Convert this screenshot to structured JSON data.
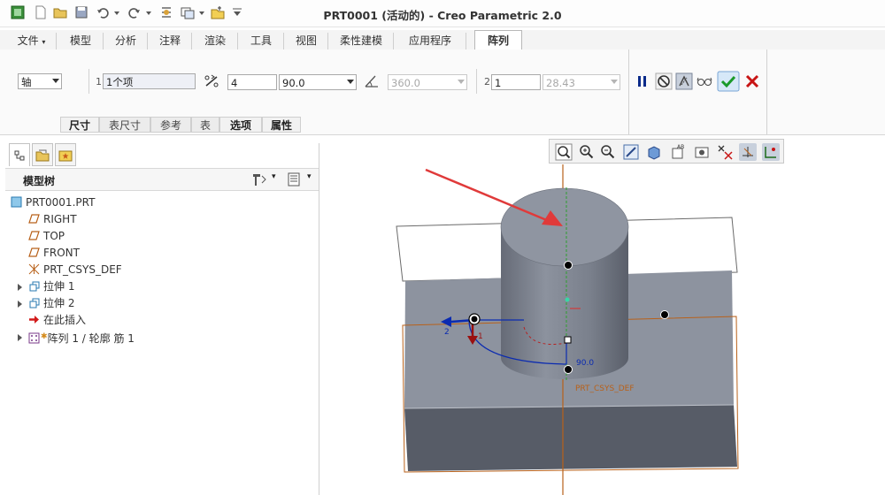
{
  "window": {
    "title": "PRT0001 (活动的) - Creo Parametric 2.0"
  },
  "ribbon_tabs": [
    {
      "label": "文件",
      "has_dropdown": true
    },
    {
      "label": "模型"
    },
    {
      "label": "分析"
    },
    {
      "label": "注释"
    },
    {
      "label": "渲染"
    },
    {
      "label": "工具"
    },
    {
      "label": "视图"
    },
    {
      "label": "柔性建模"
    },
    {
      "label": "应用程序"
    },
    {
      "label": "阵列",
      "active": true
    }
  ],
  "dashboard": {
    "pattern_type": "轴",
    "dir1": {
      "index": "1",
      "value": "1个项"
    },
    "members_count": "4",
    "angle_increment": "90.0",
    "angle_extent": "360.0",
    "dir2": {
      "index": "2",
      "count": "1",
      "spacing": "28.43"
    },
    "subtabs": [
      "尺寸",
      "表尺寸",
      "参考",
      "表",
      "选项",
      "属性"
    ],
    "buttons": [
      "pause-icon",
      "no-preview-icon",
      "feature-preview-icon",
      "glasses-icon",
      "confirm-check-icon",
      "cancel-x-icon"
    ]
  },
  "model_tree": {
    "title": "模型树",
    "items": [
      {
        "label": "PRT0001.PRT",
        "icon": "part-icon"
      },
      {
        "label": "RIGHT",
        "icon": "datum-plane-icon"
      },
      {
        "label": "TOP",
        "icon": "datum-plane-icon"
      },
      {
        "label": "FRONT",
        "icon": "datum-plane-icon"
      },
      {
        "label": "PRT_CSYS_DEF",
        "icon": "csys-icon"
      },
      {
        "label": "拉伸 1",
        "icon": "extrude-icon",
        "expandable": true
      },
      {
        "label": "拉伸 2",
        "icon": "extrude-icon",
        "expandable": true
      },
      {
        "label": "在此插入",
        "icon": "insert-arrow-icon"
      },
      {
        "label": "阵列 1 / 轮廓 筋 1",
        "icon": "pattern-icon",
        "expandable": true
      }
    ]
  },
  "graphics": {
    "dir1_label": "1",
    "dir2_label": "2",
    "angle_label": "90.0",
    "csys_label": "PRT_CSYS_DEF"
  },
  "colors": {
    "accent_blue": "#0b2bb0",
    "model_gray": "#7f8694",
    "confirm_green": "#1a9a2a",
    "cancel_red": "#c81414",
    "datum_orange": "#b8611a",
    "annotation_red": "#e03a3a"
  }
}
